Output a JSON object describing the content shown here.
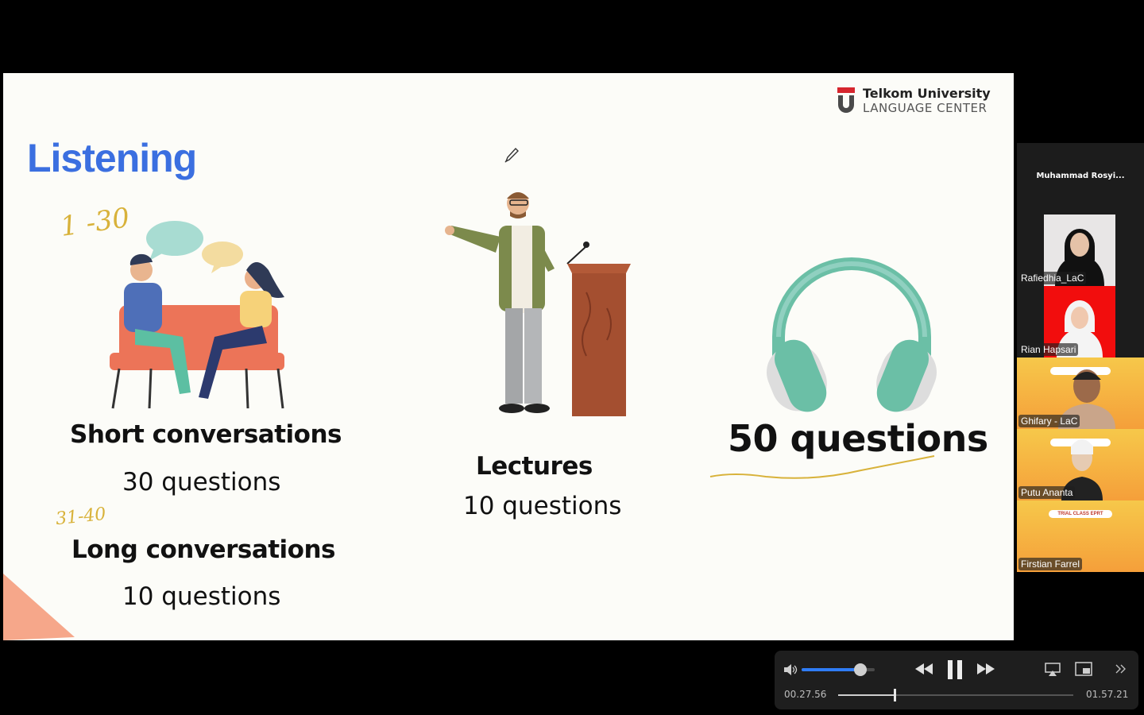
{
  "slide": {
    "logo": {
      "line1": "Telkom University",
      "line2": "LANGUAGE CENTER"
    },
    "title": "Listening",
    "sections": [
      {
        "heading": "Short conversations",
        "count": "30 questions"
      },
      {
        "heading": "Long conversations",
        "count": "10 questions"
      },
      {
        "heading": "Lectures",
        "count": "10 questions"
      },
      {
        "heading": "50 questions"
      }
    ],
    "annotations": {
      "range1": "1 -30",
      "range2": "31-40"
    }
  },
  "participants": {
    "host": "Muhammad  Rosyi...",
    "tiles": [
      {
        "name": "Rafiedhia_LaC"
      },
      {
        "name": "Rian Hapsari"
      },
      {
        "name": "Ghifary -  LaC"
      },
      {
        "name": "Putu Ananta"
      },
      {
        "name": "Firstian Farrel"
      }
    ],
    "banner_text": "TRIAL CLASS EPRT"
  },
  "player": {
    "current_time": "00.27.56",
    "total_time": "01.57.21",
    "volume": 0.8,
    "progress": 0.24
  },
  "colors": {
    "accent_blue": "#3b6fe0",
    "brand_red": "#d6262e",
    "teal": "#6bbfa6"
  }
}
